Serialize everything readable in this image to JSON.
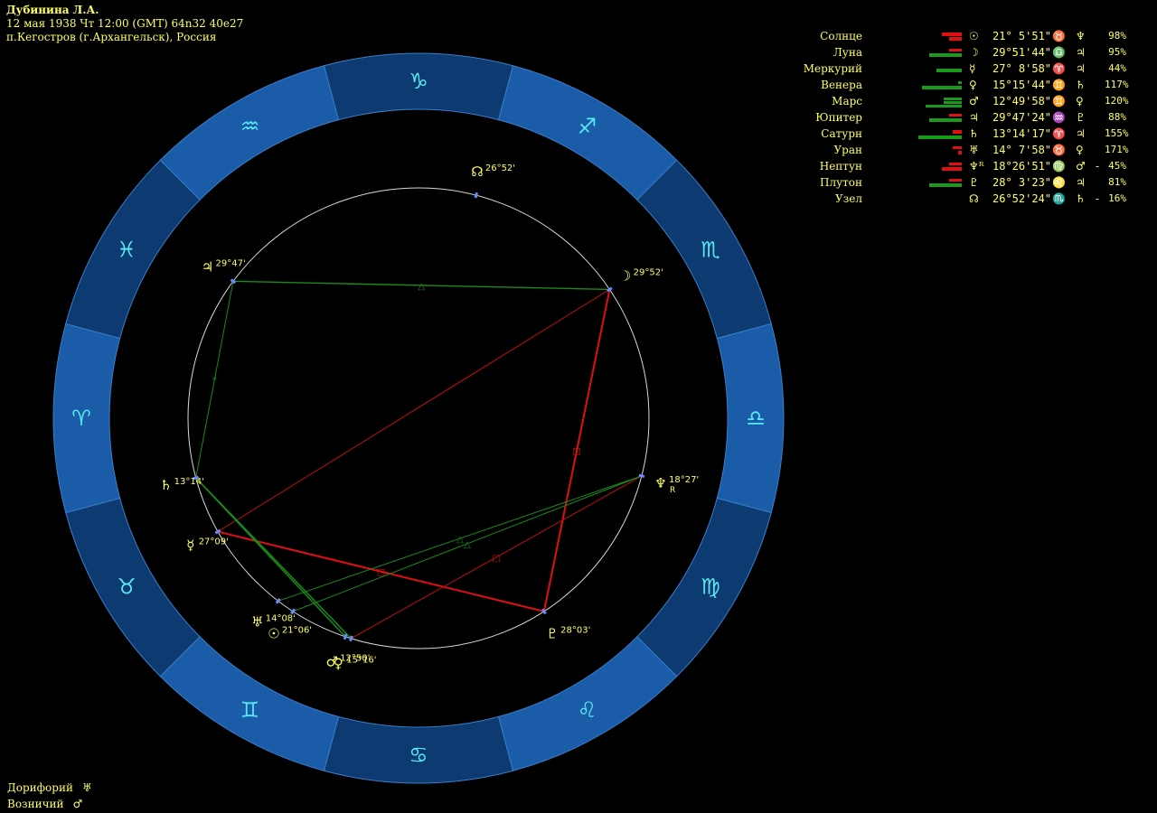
{
  "header": {
    "name": "Дубинина Л.А.",
    "datetime": "12 мая 1938  Чт  12:00 (GMT) 64n32  40e27",
    "place": "п.Кегостров (г.Архангельск), Россия"
  },
  "zodiac": {
    "signs": [
      {
        "name": "capricorn",
        "glyph": "♑",
        "angle": 0
      },
      {
        "name": "sagittarius",
        "glyph": "♐",
        "angle": 30
      },
      {
        "name": "scorpio",
        "glyph": "♏",
        "angle": 60
      },
      {
        "name": "libra",
        "glyph": "♎",
        "angle": 90
      },
      {
        "name": "virgo",
        "glyph": "♍",
        "angle": 120
      },
      {
        "name": "leo",
        "glyph": "♌",
        "angle": 150
      },
      {
        "name": "cancer",
        "glyph": "♋",
        "angle": 180
      },
      {
        "name": "gemini",
        "glyph": "♊",
        "angle": 210
      },
      {
        "name": "taurus",
        "glyph": "♉",
        "angle": 240
      },
      {
        "name": "aries",
        "glyph": "♈",
        "angle": 270
      },
      {
        "name": "pisces",
        "glyph": "♓",
        "angle": 300
      },
      {
        "name": "aquarius",
        "glyph": "♒",
        "angle": 330
      }
    ],
    "ring_color": "#1a5ca8",
    "ring_dark": "#0d3a70",
    "glyph_color": "#5ae8f0"
  },
  "wheel_planets": [
    {
      "id": "node",
      "glyph": "☊",
      "label": "26°52'",
      "angle": 14.5
    },
    {
      "id": "moon",
      "glyph": "☽",
      "label": "29°52'",
      "angle": 56
    },
    {
      "id": "neptune",
      "glyph": "♆",
      "label": "18°27'",
      "angle": 104.5,
      "retro": "R"
    },
    {
      "id": "pluto",
      "glyph": "♇",
      "label": "28°03'",
      "angle": 147
    },
    {
      "id": "venus",
      "glyph": "♀",
      "label": "15°16'",
      "angle": 197
    },
    {
      "id": "mars",
      "glyph": "♂",
      "label": "12°50'",
      "angle": 198.5
    },
    {
      "id": "sun",
      "glyph": "☉",
      "label": "21°06'",
      "angle": 213
    },
    {
      "id": "uranus",
      "glyph": "♅",
      "label": "14°08'",
      "angle": 217.5
    },
    {
      "id": "mercury",
      "glyph": "☿",
      "label": "27°09'",
      "angle": 240.5
    },
    {
      "id": "saturn",
      "glyph": "♄",
      "label": "13°14'",
      "angle": 255
    },
    {
      "id": "jupiter",
      "glyph": "♃",
      "label": "29°47'",
      "angle": 306.5
    }
  ],
  "aspects": [
    {
      "a": "moon",
      "b": "jupiter",
      "color": "#1a8a1a",
      "width": 1.4,
      "mark": "△"
    },
    {
      "a": "jupiter",
      "b": "saturn",
      "color": "#1a8a1a",
      "width": 1,
      "mark": "*"
    },
    {
      "a": "moon",
      "b": "pluto",
      "color": "#e01010",
      "width": 2,
      "mark": "□"
    },
    {
      "a": "mercury",
      "b": "pluto",
      "color": "#e01010",
      "width": 2,
      "mark": "□"
    },
    {
      "a": "moon",
      "b": "mercury",
      "color": "#c01010",
      "width": 1,
      "mark": ""
    },
    {
      "a": "neptune",
      "b": "venus",
      "color": "#c01010",
      "width": 1,
      "mark": "□"
    },
    {
      "a": "neptune",
      "b": "sun",
      "color": "#1a8a1a",
      "width": 1,
      "mark": "△"
    },
    {
      "a": "neptune",
      "b": "uranus",
      "color": "#1a8a1a",
      "width": 1,
      "mark": "△"
    },
    {
      "a": "saturn",
      "b": "venus",
      "color": "#1a8a1a",
      "width": 1.5,
      "mark": ""
    },
    {
      "a": "saturn",
      "b": "mars",
      "color": "#1a8a1a",
      "width": 1.5,
      "mark": "*"
    }
  ],
  "planet_table": [
    {
      "name": "Солнце",
      "glyph": "☉",
      "deg": "21° 5'51\"",
      "sign": "♉",
      "ruler": "♆",
      "mark": "",
      "pct": "98%",
      "bars": [
        {
          "c": "#e01010",
          "w": 22,
          "h": 4,
          "y": 2
        },
        {
          "c": "#e01010",
          "w": 14,
          "h": 4,
          "y": 7
        }
      ]
    },
    {
      "name": "Луна",
      "glyph": "☽",
      "deg": "29°51'44\"",
      "sign": "♎",
      "ruler": "♃",
      "mark": "",
      "pct": "95%",
      "bars": [
        {
          "c": "#e01010",
          "w": 14,
          "h": 3,
          "y": 2
        },
        {
          "c": "#1a9a1a",
          "w": 36,
          "h": 4,
          "y": 7
        }
      ]
    },
    {
      "name": "Меркурий",
      "glyph": "☿",
      "deg": "27° 8'58\"",
      "sign": "♈",
      "ruler": "♃",
      "mark": "",
      "pct": "44%",
      "bars": [
        {
          "c": "#1a9a1a",
          "w": 28,
          "h": 4,
          "y": 6
        }
      ]
    },
    {
      "name": "Венера",
      "glyph": "♀",
      "deg": "15°15'44\"",
      "sign": "♊",
      "ruler": "♄",
      "mark": "",
      "pct": "117%",
      "bars": [
        {
          "c": "#1a9a1a",
          "w": 4,
          "h": 3,
          "y": 2
        },
        {
          "c": "#1a9a1a",
          "w": 44,
          "h": 4,
          "y": 7
        }
      ]
    },
    {
      "name": "Марс",
      "glyph": "♂",
      "deg": "12°49'58\"",
      "sign": "♊",
      "ruler": "♀",
      "mark": "",
      "pct": "120%",
      "bars": [
        {
          "c": "#1a9a1a",
          "w": 20,
          "h": 3,
          "y": 2
        },
        {
          "c": "#1a9a1a",
          "w": 20,
          "h": 3,
          "y": 6
        },
        {
          "c": "#1a9a1a",
          "w": 40,
          "h": 3,
          "y": 10
        }
      ]
    },
    {
      "name": "Юпитер",
      "glyph": "♃",
      "deg": "29°47'24\"",
      "sign": "♒",
      "ruler": "♇",
      "mark": "",
      "pct": "88%",
      "bars": [
        {
          "c": "#e01010",
          "w": 14,
          "h": 3,
          "y": 2
        },
        {
          "c": "#1a9a1a",
          "w": 36,
          "h": 4,
          "y": 7
        }
      ]
    },
    {
      "name": "Сатурн",
      "glyph": "♄",
      "deg": "13°14'17\"",
      "sign": "♈",
      "ruler": "♃",
      "mark": "",
      "pct": "155%",
      "bars": [
        {
          "c": "#e01010",
          "w": 10,
          "h": 4,
          "y": 2
        },
        {
          "c": "#1a9a1a",
          "w": 48,
          "h": 4,
          "y": 8
        }
      ]
    },
    {
      "name": "Уран",
      "glyph": "♅",
      "deg": "14° 7'58\"",
      "sign": "♉",
      "ruler": "♀",
      "mark": "",
      "pct": "171%",
      "bars": [
        {
          "c": "#e01010",
          "w": 10,
          "h": 3,
          "y": 2
        },
        {
          "c": "#e01010",
          "w": 4,
          "h": 4,
          "y": 7
        }
      ]
    },
    {
      "name": "Нептун",
      "glyph": "♆ᴿ",
      "deg": "18°26'51\"",
      "sign": "♍",
      "ruler": "♂",
      "mark": "-",
      "pct": "45%",
      "bars": [
        {
          "c": "#e01010",
          "w": 14,
          "h": 3,
          "y": 2
        },
        {
          "c": "#e01010",
          "w": 22,
          "h": 4,
          "y": 7
        }
      ]
    },
    {
      "name": "Плутон",
      "glyph": "♇",
      "deg": "28° 3'23\"",
      "sign": "♌",
      "ruler": "♃",
      "mark": "",
      "pct": "81%",
      "bars": [
        {
          "c": "#e01010",
          "w": 14,
          "h": 3,
          "y": 2
        },
        {
          "c": "#1a9a1a",
          "w": 36,
          "h": 4,
          "y": 7
        }
      ]
    },
    {
      "name": "Узел",
      "glyph": "☊",
      "deg": "26°52'24\"",
      "sign": "♏",
      "ruler": "♄",
      "mark": "-",
      "pct": "16%",
      "bars": []
    }
  ],
  "footer": [
    {
      "label": "Дорифорий",
      "glyph": "♅"
    },
    {
      "label": "Возничий",
      "glyph": "♂"
    }
  ]
}
